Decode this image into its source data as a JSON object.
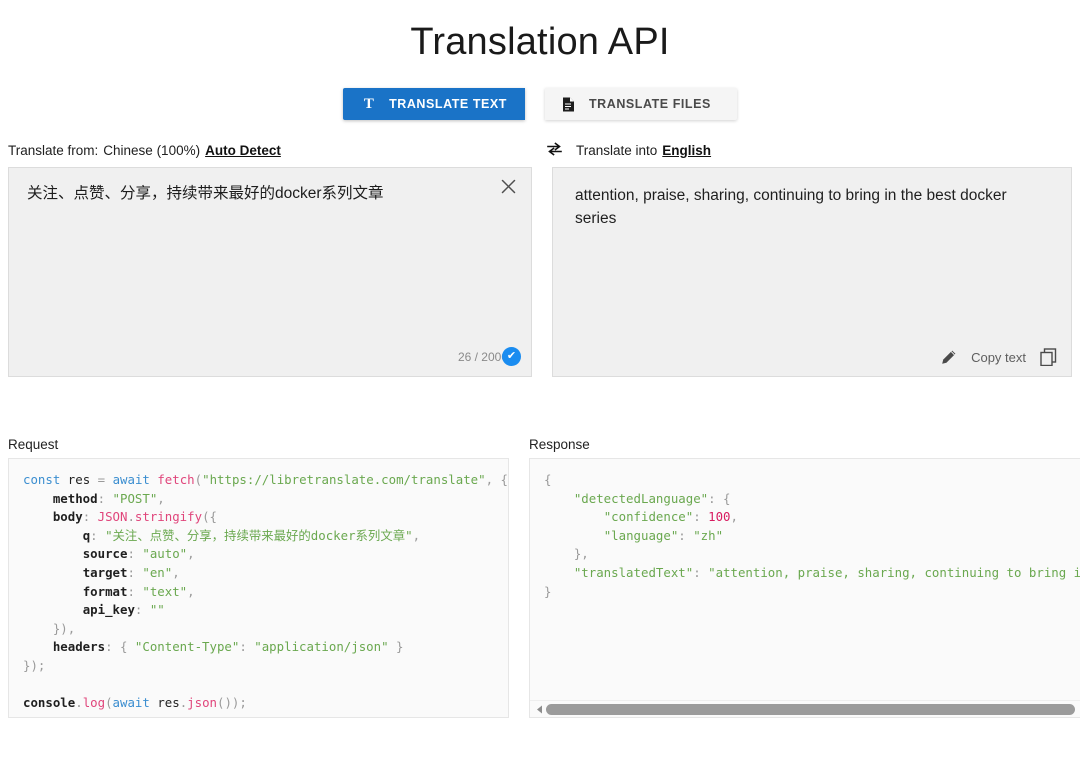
{
  "title": "Translation API",
  "tabs": [
    {
      "id": "translate-text",
      "label": "TRANSLATE TEXT",
      "icon": "text-T-icon",
      "glyph": "T",
      "active": true
    },
    {
      "id": "translate-files",
      "label": "TRANSLATE FILES",
      "icon": "file-document-icon",
      "glyph": "▤",
      "active": false
    }
  ],
  "language_bar": {
    "from_prefix": "Translate from:",
    "from_value": "Chinese (100%)",
    "auto_detect_label": "Auto Detect",
    "swap_icon": "swap-arrows-icon",
    "into_prefix": "Translate into",
    "into_value": "English"
  },
  "source_panel": {
    "text": "关注、点赞、分享，持续带来最好的docker系列文章",
    "clear_icon": "close-x-icon",
    "counter": "26 / 2000",
    "status_icon": "check-circle-icon",
    "status_glyph": "✔"
  },
  "target_panel": {
    "text": "attention, praise, sharing, continuing to bring in the best docker series",
    "edit_icon": "pencil-edit-icon",
    "copy_label": "Copy text",
    "copy_icon": "copy-pages-icon"
  },
  "request": {
    "label": "Request",
    "code_lines": [
      [
        {
          "t": "kw",
          "v": "const"
        },
        {
          "t": "plain",
          "v": " res "
        },
        {
          "t": "punc",
          "v": "="
        },
        {
          "t": "plain",
          "v": " "
        },
        {
          "t": "kw",
          "v": "await"
        },
        {
          "t": "plain",
          "v": " "
        },
        {
          "t": "fn",
          "v": "fetch"
        },
        {
          "t": "punc",
          "v": "("
        },
        {
          "t": "str",
          "v": "\"https://libretranslate.com/translate\""
        },
        {
          "t": "punc",
          "v": ", {"
        }
      ],
      [
        {
          "t": "plain",
          "v": "    "
        },
        {
          "t": "prop",
          "v": "method"
        },
        {
          "t": "punc",
          "v": ": "
        },
        {
          "t": "str",
          "v": "\"POST\""
        },
        {
          "t": "punc",
          "v": ","
        }
      ],
      [
        {
          "t": "plain",
          "v": "    "
        },
        {
          "t": "prop",
          "v": "body"
        },
        {
          "t": "punc",
          "v": ": "
        },
        {
          "t": "fn",
          "v": "JSON"
        },
        {
          "t": "punc",
          "v": "."
        },
        {
          "t": "fn",
          "v": "stringify"
        },
        {
          "t": "punc",
          "v": "({"
        }
      ],
      [
        {
          "t": "plain",
          "v": "        "
        },
        {
          "t": "prop",
          "v": "q"
        },
        {
          "t": "punc",
          "v": ": "
        },
        {
          "t": "str",
          "v": "\"关注、点赞、分享，持续带来最好的docker系列文章\""
        },
        {
          "t": "punc",
          "v": ","
        }
      ],
      [
        {
          "t": "plain",
          "v": "        "
        },
        {
          "t": "prop",
          "v": "source"
        },
        {
          "t": "punc",
          "v": ": "
        },
        {
          "t": "str",
          "v": "\"auto\""
        },
        {
          "t": "punc",
          "v": ","
        }
      ],
      [
        {
          "t": "plain",
          "v": "        "
        },
        {
          "t": "prop",
          "v": "target"
        },
        {
          "t": "punc",
          "v": ": "
        },
        {
          "t": "str",
          "v": "\"en\""
        },
        {
          "t": "punc",
          "v": ","
        }
      ],
      [
        {
          "t": "plain",
          "v": "        "
        },
        {
          "t": "prop",
          "v": "format"
        },
        {
          "t": "punc",
          "v": ": "
        },
        {
          "t": "str",
          "v": "\"text\""
        },
        {
          "t": "punc",
          "v": ","
        }
      ],
      [
        {
          "t": "plain",
          "v": "        "
        },
        {
          "t": "prop",
          "v": "api_key"
        },
        {
          "t": "punc",
          "v": ": "
        },
        {
          "t": "str",
          "v": "\"\""
        }
      ],
      [
        {
          "t": "plain",
          "v": "    "
        },
        {
          "t": "punc",
          "v": "}),"
        }
      ],
      [
        {
          "t": "plain",
          "v": "    "
        },
        {
          "t": "prop",
          "v": "headers"
        },
        {
          "t": "punc",
          "v": ": { "
        },
        {
          "t": "str",
          "v": "\"Content-Type\""
        },
        {
          "t": "punc",
          "v": ": "
        },
        {
          "t": "str",
          "v": "\"application/json\""
        },
        {
          "t": "punc",
          "v": " }"
        }
      ],
      [
        {
          "t": "punc",
          "v": "});"
        }
      ],
      [
        {
          "t": "plain",
          "v": ""
        }
      ],
      [
        {
          "t": "prop",
          "v": "console"
        },
        {
          "t": "punc",
          "v": "."
        },
        {
          "t": "fn",
          "v": "log"
        },
        {
          "t": "punc",
          "v": "("
        },
        {
          "t": "kw",
          "v": "await"
        },
        {
          "t": "plain",
          "v": " res"
        },
        {
          "t": "punc",
          "v": "."
        },
        {
          "t": "fn",
          "v": "json"
        },
        {
          "t": "punc",
          "v": "());"
        }
      ]
    ]
  },
  "response": {
    "label": "Response",
    "code_lines": [
      [
        {
          "t": "punc",
          "v": "{"
        }
      ],
      [
        {
          "t": "plain",
          "v": "    "
        },
        {
          "t": "key",
          "v": "\"detectedLanguage\""
        },
        {
          "t": "punc",
          "v": ": {"
        }
      ],
      [
        {
          "t": "plain",
          "v": "        "
        },
        {
          "t": "key",
          "v": "\"confidence\""
        },
        {
          "t": "punc",
          "v": ": "
        },
        {
          "t": "num",
          "v": "100"
        },
        {
          "t": "punc",
          "v": ","
        }
      ],
      [
        {
          "t": "plain",
          "v": "        "
        },
        {
          "t": "key",
          "v": "\"language\""
        },
        {
          "t": "punc",
          "v": ": "
        },
        {
          "t": "str",
          "v": "\"zh\""
        }
      ],
      [
        {
          "t": "plain",
          "v": "    "
        },
        {
          "t": "punc",
          "v": "},"
        }
      ],
      [
        {
          "t": "plain",
          "v": "    "
        },
        {
          "t": "key",
          "v": "\"translatedText\""
        },
        {
          "t": "punc",
          "v": ": "
        },
        {
          "t": "str",
          "v": "\"attention, praise, sharing, continuing to bring in the best docker series\""
        }
      ],
      [
        {
          "t": "punc",
          "v": "}"
        }
      ]
    ],
    "scrollbar": {
      "left_arrow_icon": "scroll-left-arrow-icon",
      "right_arrow_icon": "scroll-right-arrow-icon",
      "thumb_percent": 75
    }
  },
  "colors": {
    "accent_blue": "#1a73c7",
    "check_blue": "#1a8cf0",
    "panel_bg": "#f0f0f0",
    "code_bg": "#fafafa",
    "string_green": "#6aa84f",
    "keyword_blue": "#3b8ed0",
    "function_pink": "#e0457b",
    "number_pink": "#d81b60"
  }
}
